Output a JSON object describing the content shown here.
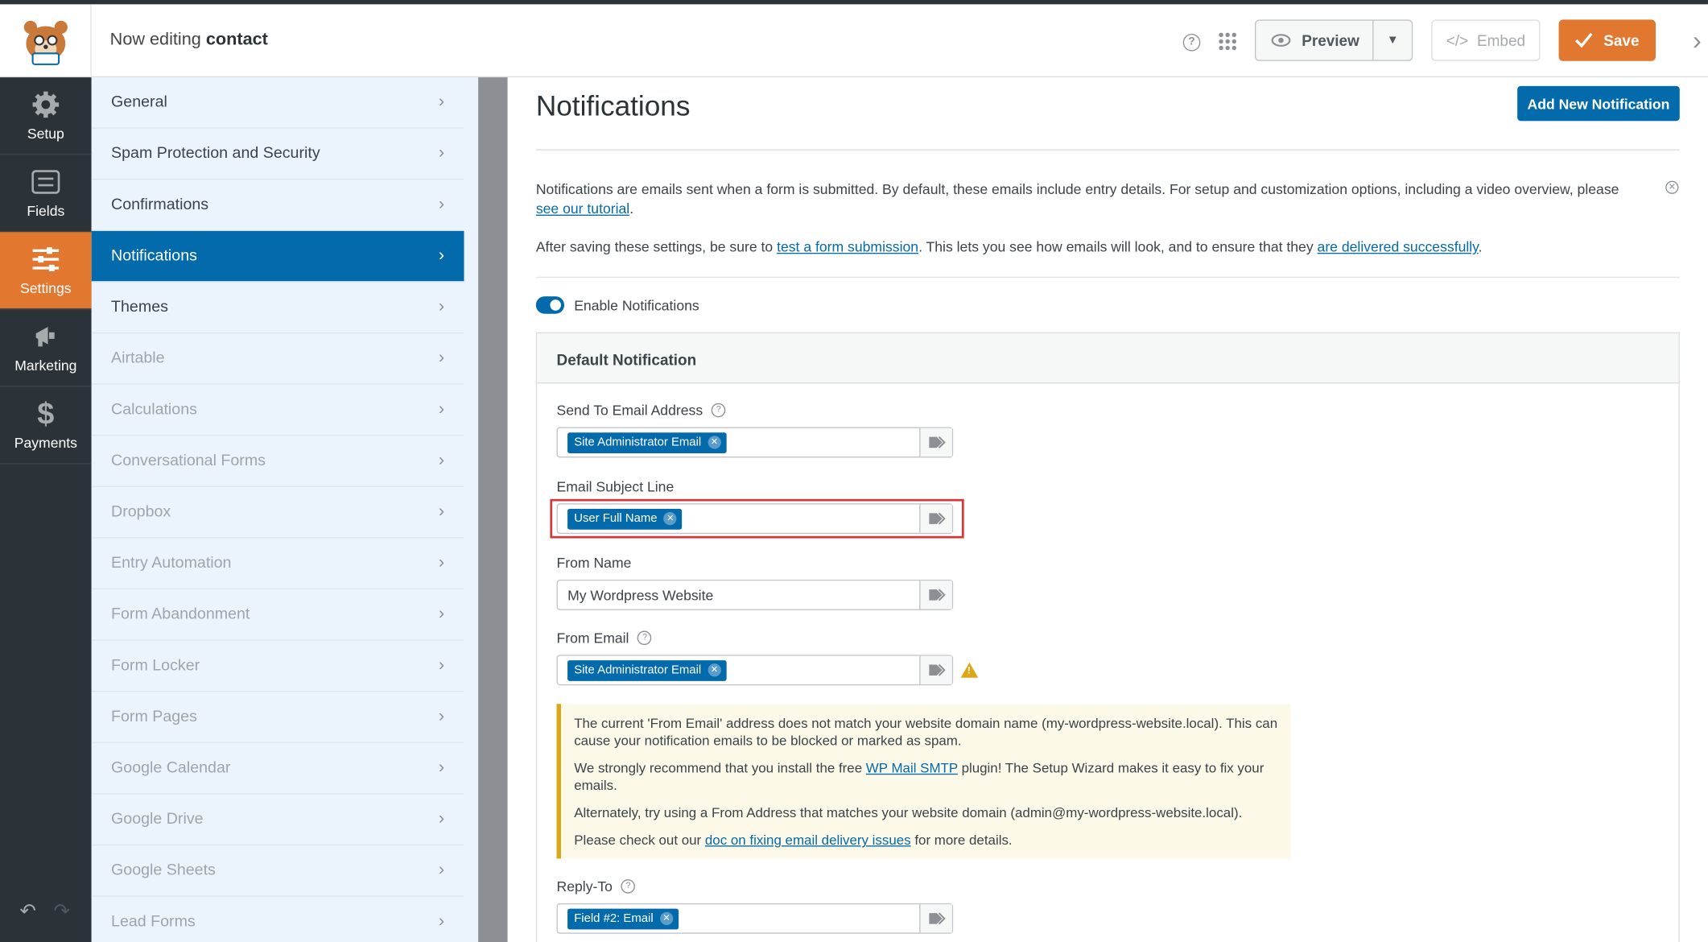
{
  "topbar": {
    "editing_prefix": "Now editing",
    "form_name": "contact",
    "preview_label": "Preview",
    "embed_label": "Embed",
    "save_label": "Save"
  },
  "leftnav": [
    {
      "label": "Setup",
      "icon": "gear-icon"
    },
    {
      "label": "Fields",
      "icon": "fields-list-icon"
    },
    {
      "label": "Settings",
      "icon": "sliders-icon",
      "active": true
    },
    {
      "label": "Marketing",
      "icon": "megaphone-icon"
    },
    {
      "label": "Payments",
      "icon": "dollar-icon"
    }
  ],
  "settings_menu": [
    {
      "label": "General"
    },
    {
      "label": "Spam Protection and Security"
    },
    {
      "label": "Confirmations"
    },
    {
      "label": "Notifications",
      "active": true
    },
    {
      "label": "Themes"
    },
    {
      "label": "Airtable",
      "disabled": true
    },
    {
      "label": "Calculations",
      "disabled": true
    },
    {
      "label": "Conversational Forms",
      "disabled": true
    },
    {
      "label": "Dropbox",
      "disabled": true
    },
    {
      "label": "Entry Automation",
      "disabled": true
    },
    {
      "label": "Form Abandonment",
      "disabled": true
    },
    {
      "label": "Form Locker",
      "disabled": true
    },
    {
      "label": "Form Pages",
      "disabled": true
    },
    {
      "label": "Google Calendar",
      "disabled": true
    },
    {
      "label": "Google Drive",
      "disabled": true
    },
    {
      "label": "Google Sheets",
      "disabled": true
    },
    {
      "label": "Lead Forms",
      "disabled": true
    }
  ],
  "main": {
    "title": "Notifications",
    "add_button": "Add New Notification",
    "info": {
      "text1": "Notifications are emails sent when a form is submitted. By default, these emails include entry details. For setup and customization options, including a video overview, please ",
      "link1": "see our tutorial",
      "text2": ".",
      "line2_a": "After saving these settings, be sure to ",
      "line2_link1": "test a form submission",
      "line2_b": ". This lets you see how emails will look, and to ensure that they ",
      "line2_link2": "are delivered successfully",
      "line2_c": "."
    },
    "toggle_label": "Enable Notifications",
    "notification": {
      "header": "Default Notification",
      "send_to_label": "Send To Email Address",
      "send_to_chip": "Site Administrator Email",
      "subject_label": "Email Subject Line",
      "subject_chip": "User Full Name",
      "from_name_label": "From Name",
      "from_name_value": "My Wordpress Website",
      "from_email_label": "From Email",
      "from_email_chip": "Site Administrator Email",
      "reply_to_label": "Reply-To",
      "reply_to_chip": "Field #2: Email"
    },
    "warning": {
      "p1": "The current 'From Email' address does not match your website domain name (my-wordpress-website.local). This can cause your notification emails to be blocked or marked as spam.",
      "p2_a": "We strongly recommend that you install the free ",
      "p2_link": "WP Mail SMTP",
      "p2_b": " plugin! The Setup Wizard makes it easy to fix your emails.",
      "p3": "Alternately, try using a From Address that matches your website domain (admin@my-wordpress-website.local).",
      "p4_a": "Please check out our ",
      "p4_link": "doc on fixing email delivery issues",
      "p4_b": " for more details."
    }
  },
  "colors": {
    "accent_orange": "#e27730",
    "primary_blue": "#036aab",
    "nav_dark": "#2c3338",
    "highlight_red": "#d63638",
    "warning_yellow": "#dba617"
  }
}
